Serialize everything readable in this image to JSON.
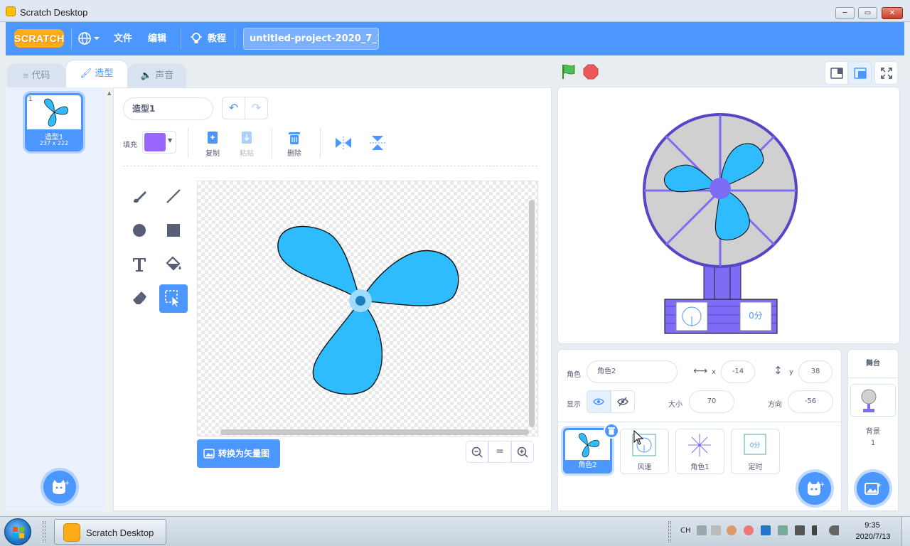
{
  "window": {
    "title": "Scratch Desktop"
  },
  "menubar": {
    "logo": "SCRATCH",
    "file": "文件",
    "edit": "编辑",
    "tutorials": "教程",
    "project_name": "untitled-project-2020_7_1..."
  },
  "tabs": [
    {
      "label": "代码",
      "active": false
    },
    {
      "label": "造型",
      "active": true
    },
    {
      "label": "声音",
      "active": false
    }
  ],
  "costumes": [
    {
      "number": "1",
      "name": "造型1",
      "size": "237 x 222",
      "selected": true
    }
  ],
  "editor": {
    "costume_name": "造型1",
    "fill_label": "填充",
    "fill_color": "#9966ff",
    "copy": "复制",
    "paste": "粘贴",
    "delete": "删除",
    "convert_button": "转换为矢量图",
    "zoom_reset": "="
  },
  "colors": {
    "accent": "#4c97ff",
    "fan_blade": "#2ebcff",
    "fan_ring": "#7d6cf5",
    "stage_fan_gray": "#d0d0d0"
  },
  "stage": {
    "timer_text": "0分"
  },
  "sprite_info": {
    "sprite_label": "角色",
    "sprite_name": "角色2",
    "x_label": "x",
    "x": "-14",
    "y_label": "y",
    "y": "38",
    "show_label": "显示",
    "size_label": "大小",
    "size": "70",
    "direction_label": "方向",
    "direction": "-56"
  },
  "sprites": [
    {
      "name": "角色2",
      "selected": true
    },
    {
      "name": "风速",
      "selected": false
    },
    {
      "name": "角色1",
      "selected": false
    },
    {
      "name": "定时",
      "selected": false
    }
  ],
  "sprite_tile_timer": "0分",
  "stage_panel": {
    "title": "舞台",
    "backdrop_label": "背景",
    "backdrop_count": "1"
  },
  "taskbar": {
    "app": "Scratch Desktop",
    "lang": "CH",
    "time": "9:35",
    "date": "2020/7/13"
  }
}
